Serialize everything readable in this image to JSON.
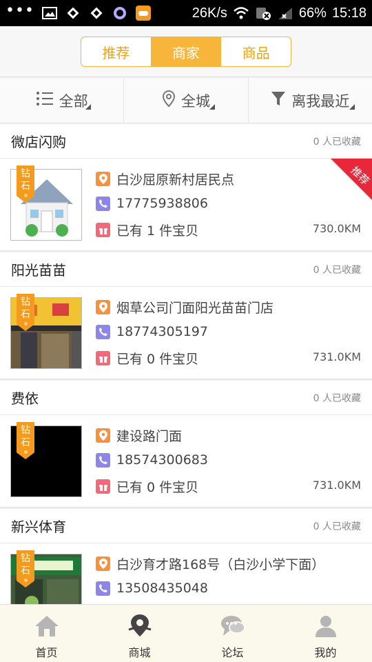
{
  "status_bar": {
    "speed": "26K/s",
    "battery": "66%",
    "time": "15:18"
  },
  "tabs": [
    {
      "label": "推荐",
      "active": false
    },
    {
      "label": "商家",
      "active": true
    },
    {
      "label": "商品",
      "active": false
    }
  ],
  "filters": {
    "category": "全部",
    "area": "全城",
    "sort": "离我最近"
  },
  "badge_label": {
    "line1": "钻",
    "line2": "石"
  },
  "shops": [
    {
      "name": "微店闪购",
      "favorites": "0 人已收藏",
      "address": "白沙屈原新村居民点",
      "phone": "17775938806",
      "items": "已有 1 件宝贝",
      "distance": "730.0KM",
      "ribbon": "推荐"
    },
    {
      "name": "阳光苗苗",
      "favorites": "0 人已收藏",
      "address": "烟草公司门面阳光苗苗门店",
      "phone": "18774305197",
      "items": "已有 0 件宝贝",
      "distance": "731.0KM"
    },
    {
      "name": "费依",
      "favorites": "0 人已收藏",
      "address": "建设路门面",
      "phone": "18574300683",
      "items": "已有 0 件宝贝",
      "distance": "731.0KM"
    },
    {
      "name": "新兴体育",
      "favorites": "0 人已收藏",
      "address": "白沙育才路168号（白沙小学下面）",
      "phone": "13508435048",
      "items": "",
      "distance": ""
    }
  ],
  "bottom_nav": [
    {
      "label": "首页",
      "icon": "home-icon"
    },
    {
      "label": "商城",
      "icon": "map-pin-icon",
      "active": true
    },
    {
      "label": "论坛",
      "icon": "chat-bubble-icon"
    },
    {
      "label": "我的",
      "icon": "person-icon"
    }
  ],
  "colors": {
    "accent": "#f7b53b",
    "ribbon": "#e8283a",
    "badge": "#f39a1f"
  }
}
